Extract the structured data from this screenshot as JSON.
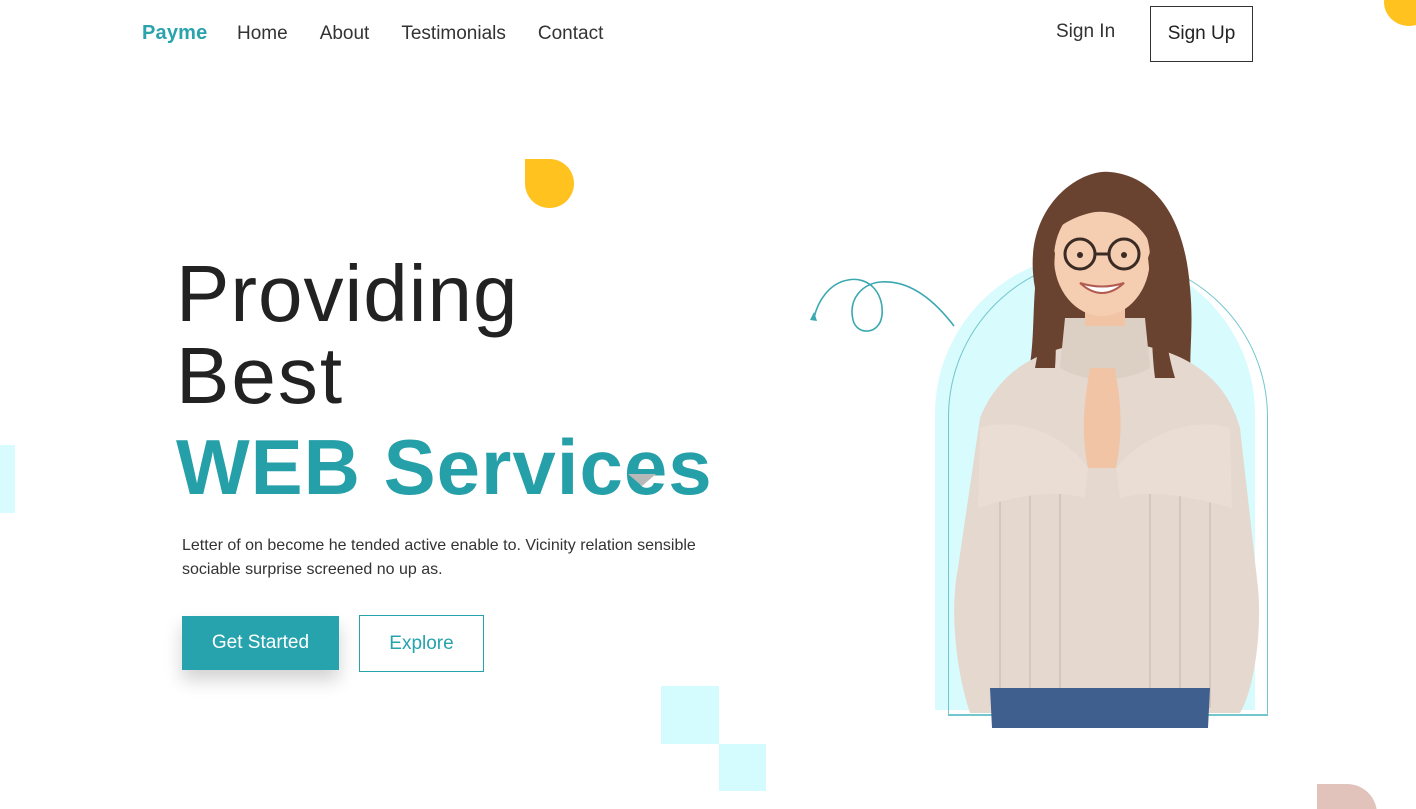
{
  "nav": {
    "logo": "Payme",
    "links": [
      "Home",
      "About",
      "Testimonials",
      "Contact"
    ],
    "sign_in": "Sign In",
    "sign_up": "Sign Up"
  },
  "hero": {
    "line1": "Providing",
    "line2": "Best",
    "accent": "WEB Services",
    "description": "Letter of on become he tended active enable to. Vicinity relation sensible sociable surprise screened no up as.",
    "primary_button": "Get Started",
    "secondary_button": "Explore",
    "image_alt": "smiling-woman-photo"
  },
  "colors": {
    "accent": "#27a3ad",
    "yellow": "#ffc21f",
    "light_cyan": "#d8fbfd",
    "pink": "#e2c3bc"
  }
}
